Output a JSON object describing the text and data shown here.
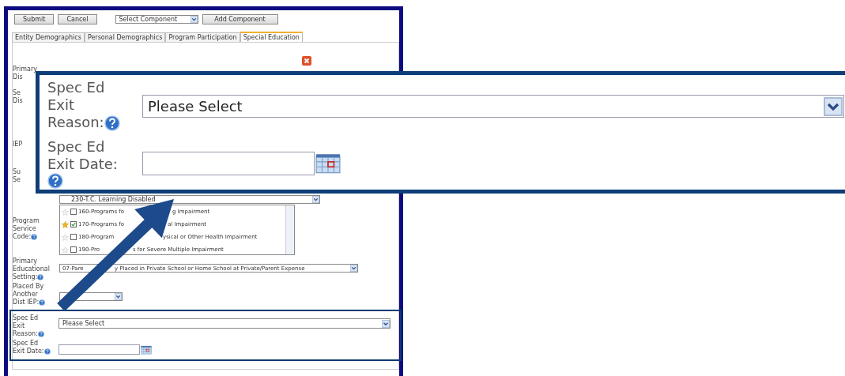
{
  "toolbar": {
    "buttons": [
      {
        "label": "Submit"
      },
      {
        "label": "Cancel"
      }
    ],
    "component_select": "Select Component",
    "add_button": "Add Component"
  },
  "tabs": [
    {
      "label": "Entity Demographics",
      "selected": false
    },
    {
      "label": "Personal Demographics",
      "selected": false
    },
    {
      "label": "Program Participation",
      "selected": false
    },
    {
      "label": "Special Education",
      "selected": true
    }
  ],
  "form": {
    "covered_labels": [
      {
        "lines": [
          "Primary",
          "Dis"
        ]
      },
      {
        "lines": [
          "Se",
          "Dis"
        ]
      },
      {
        "lines": [
          "IEP"
        ]
      },
      {
        "lines": [
          "Su",
          "Se"
        ]
      }
    ],
    "upper_select": "230-T.C. Learning Disabled",
    "program_service_code": {
      "label": [
        "Program",
        "Service",
        "Code:"
      ],
      "items": [
        {
          "parts": [
            "160-Programs fo",
            "g Impairment"
          ],
          "checked": false,
          "starred": false
        },
        {
          "parts": [
            "170-Programs fo",
            "al Impairment"
          ],
          "checked": true,
          "starred": true
        },
        {
          "parts": [
            "180-Program",
            "ysical or Other Health Impairment"
          ],
          "checked": false,
          "starred": false
        },
        {
          "parts": [
            "190-Pro",
            "s for Severe Multiple Impairment"
          ],
          "checked": false,
          "starred": false
        }
      ]
    },
    "educational_setting": {
      "label": [
        "Primary",
        "Educational",
        "Setting:"
      ],
      "parts": [
        "07-Pare",
        "y Placed in Private School or Home School at Private/Parent Expense"
      ]
    },
    "placed_by": {
      "label": [
        "Placed By",
        "Another",
        "Dist IEP:"
      ]
    },
    "exit_reason": {
      "label": [
        "Spec Ed",
        "Exit",
        "Reason:"
      ],
      "value": "Please Select"
    },
    "exit_date": {
      "label": [
        "Spec Ed",
        "Exit Date:"
      ]
    }
  },
  "callout": {
    "exit_reason": {
      "label": [
        "Spec Ed",
        "Exit",
        "Reason:"
      ],
      "value": "Please Select"
    },
    "exit_date": {
      "label": [
        "Spec Ed",
        "Exit Date:"
      ]
    }
  }
}
